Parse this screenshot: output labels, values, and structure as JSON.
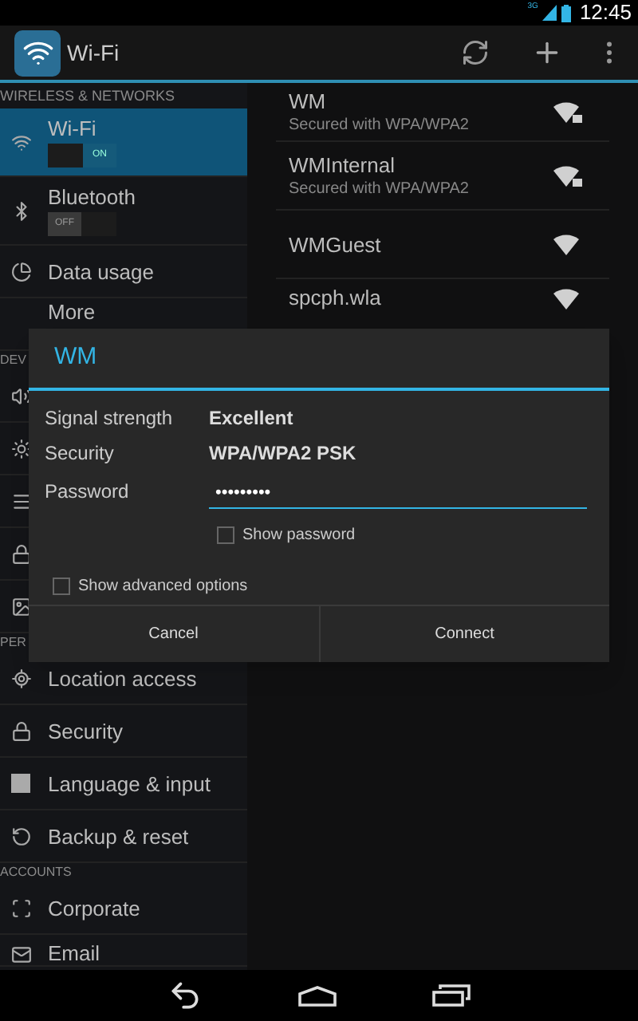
{
  "status_bar": {
    "network": "3G",
    "time": "12:45"
  },
  "action_bar": {
    "title": "Wi-Fi"
  },
  "sidebar": {
    "sections": [
      {
        "header": "WIRELESS & NETWORKS",
        "items": [
          {
            "label": "Wi-Fi",
            "kind": "toggle",
            "on": true,
            "toggle_text": "ON",
            "selected": true
          },
          {
            "label": "Bluetooth",
            "kind": "toggle",
            "on": false,
            "toggle_text": "OFF",
            "selected": false
          },
          {
            "label": "Data usage",
            "kind": "plain",
            "selected": false
          },
          {
            "label": "More",
            "kind": "plain",
            "selected": false
          }
        ]
      },
      {
        "header": "DEV"
      },
      {
        "header": "PER",
        "items": [
          {
            "label": "Location access",
            "kind": "plain",
            "selected": false
          },
          {
            "label": "Security",
            "kind": "plain",
            "selected": false
          },
          {
            "label": "Language & input",
            "kind": "plain",
            "selected": false
          },
          {
            "label": "Backup & reset",
            "kind": "plain",
            "selected": false
          }
        ]
      },
      {
        "header": "ACCOUNTS",
        "items": [
          {
            "label": "Corporate",
            "kind": "plain",
            "selected": false
          },
          {
            "label": "Email",
            "kind": "plain",
            "selected": false
          }
        ]
      }
    ]
  },
  "networks": [
    {
      "name": "WM",
      "subtitle": "Secured with WPA/WPA2",
      "locked": true
    },
    {
      "name": "WMInternal",
      "subtitle": "Secured with WPA/WPA2",
      "locked": true
    },
    {
      "name": "WMGuest",
      "locked": false
    },
    {
      "name": "spcph.wla",
      "locked": false
    }
  ],
  "dialog": {
    "title": "WM",
    "info": [
      {
        "label": "Signal strength",
        "value": "Excellent"
      },
      {
        "label": "Security",
        "value": "WPA/WPA2 PSK"
      }
    ],
    "password": {
      "label": "Password",
      "value": "•••••••••"
    },
    "show_password": {
      "label": "Show password",
      "checked": false
    },
    "advanced": {
      "label": "Show advanced options",
      "checked": false
    },
    "buttons": [
      "Cancel",
      "Connect"
    ]
  }
}
